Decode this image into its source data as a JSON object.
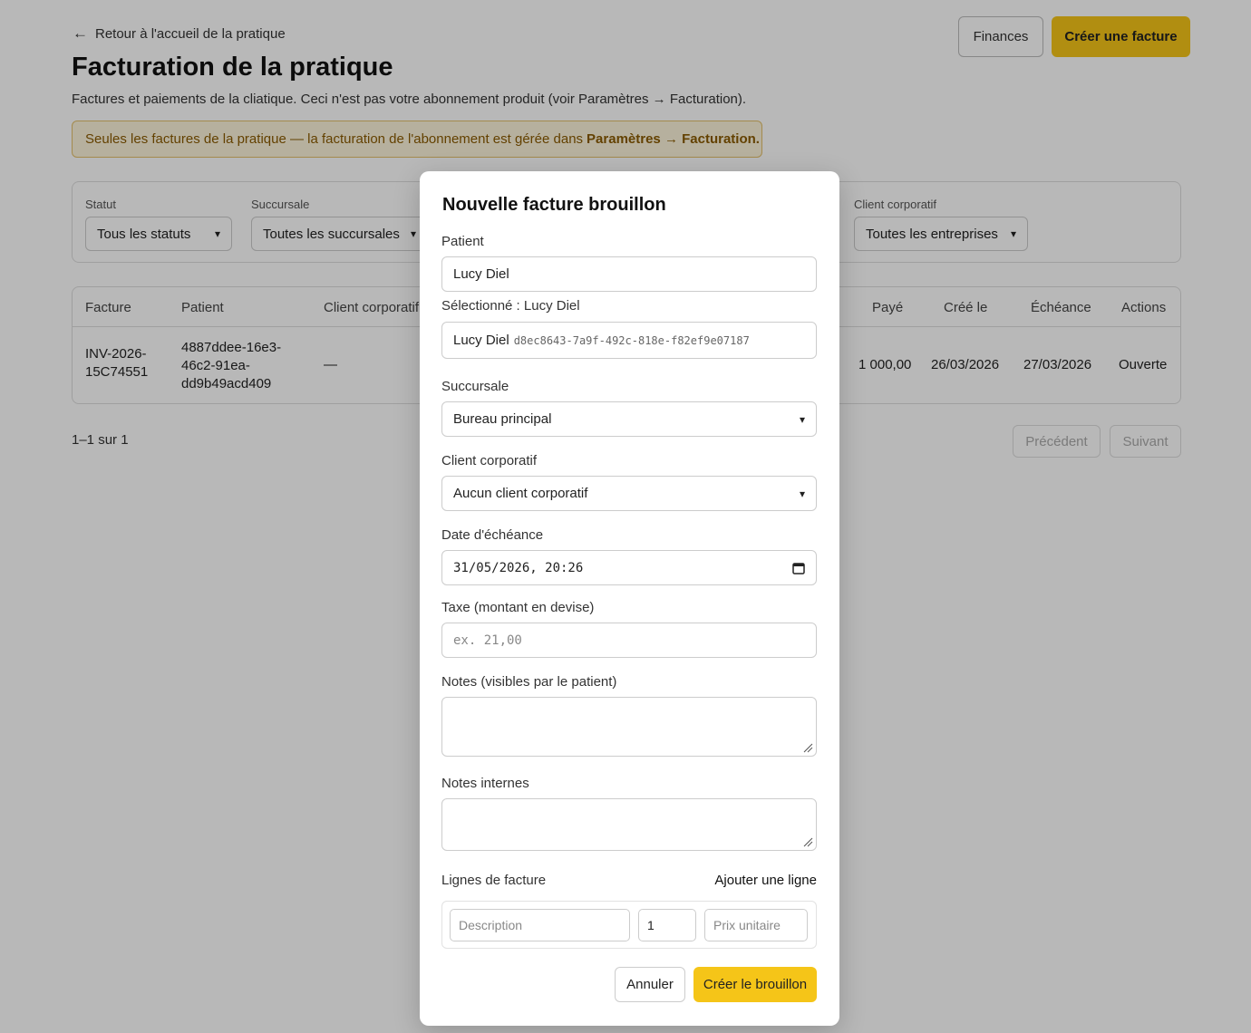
{
  "header": {
    "back_link": "Retour à l'accueil de la pratique",
    "title": "Facturation de la pratique",
    "subtitle": "Factures et paiements de la cliatique. Ceci n'est pas votre abonnement produit (voir Paramètres → Facturation).",
    "finances_label": "Finances",
    "create_invoice_label": "Créer une facture"
  },
  "notice": {
    "text": "Seules les factures de la pratique — la facturation de l'abonnement est gérée dans",
    "link": "Paramètres  →  Facturation."
  },
  "filters": {
    "status": {
      "label": "Statut",
      "value": "Tous les statuts"
    },
    "branch": {
      "label": "Succursale",
      "value": "Toutes les succursales"
    },
    "corporate": {
      "label": "Client corporatif",
      "value": "Toutes les entreprises"
    }
  },
  "table": {
    "headers": {
      "invoice": "Facture",
      "patient": "Patient",
      "corporate": "Client corporatif",
      "paid": "Payé",
      "created": "Créé le",
      "due": "Échéance",
      "actions": "Actions"
    },
    "rows": [
      {
        "invoice_l1": "INV-2026-",
        "invoice_l2": "15C74551",
        "patient_l1": "4887ddee-16e3-",
        "patient_l2": "46c2-91ea-",
        "patient_l3": "dd9b49acd409",
        "corporate": "—",
        "paid": "1 000,00",
        "created": "26/03/2026",
        "due": "27/03/2026",
        "action": "Ouverte"
      }
    ]
  },
  "pager": {
    "text": "1–1 sur 1",
    "prev": "Précédent",
    "next": "Suivant"
  },
  "modal": {
    "title": "Nouvelle facture brouillon",
    "patient_label": "Patient",
    "patient_value": "Lucy Diel",
    "selected_label": "Sélectionné : Lucy Diel",
    "selected_name": "Lucy Diel",
    "selected_id": "d8ec8643-7a9f-492c-818e-f82ef9e07187",
    "branch_label": "Succursale",
    "branch_value": "Bureau principal",
    "corporate_label": "Client corporatif",
    "corporate_value": "Aucun client corporatif",
    "due_label": "Date d'échéance",
    "due_value": "31/05/2026, 20:26",
    "tax_label": "Taxe (montant en devise)",
    "tax_placeholder": "ex. 21,00",
    "notes_label": "Notes (visibles par le patient)",
    "internal_notes_label": "Notes internes",
    "lines_label": "Lignes de facture",
    "add_line_label": "Ajouter une ligne",
    "line_description_placeholder": "Description",
    "line_qty_value": "1",
    "line_price_placeholder": "Prix unitaire",
    "cancel_label": "Annuler",
    "submit_label": "Créer le brouillon"
  },
  "colors": {
    "accent": "#f5c518",
    "notice_bg": "#fdf4dc",
    "notice_text": "#8a5a00",
    "overlay": "rgba(0,0,0,0.28)"
  }
}
